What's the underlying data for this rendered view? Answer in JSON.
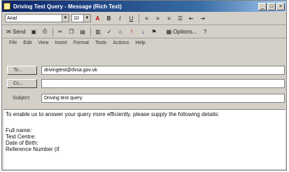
{
  "window": {
    "title": "Driving Test Query - Message (Rich Text)",
    "controls": [
      "_",
      "□",
      "×"
    ]
  },
  "format_toolbar": {
    "font": "Arial",
    "size": "10",
    "buttons": [
      "A",
      "B",
      "I",
      "U"
    ]
  },
  "standard_toolbar": {
    "send_label": "Send",
    "options_label": "Options..."
  },
  "menu": [
    "File",
    "Edit",
    "View",
    "Insert",
    "Format",
    "Tools",
    "Actions",
    "Help"
  ],
  "fields": {
    "to_label": "To...",
    "to_value": "drivingtest@dvsa.gov.uk",
    "cc_label": "Cc...",
    "cc_value": "",
    "subject_label": "Subject:",
    "subject_value": "Driving test query"
  },
  "body": {
    "intro": "To enable us to answer your query more efficiently, please supply the following details:",
    "items": [
      "Full name:",
      "Test Centre:",
      "Date of Birth:",
      "Reference Number (if"
    ]
  }
}
